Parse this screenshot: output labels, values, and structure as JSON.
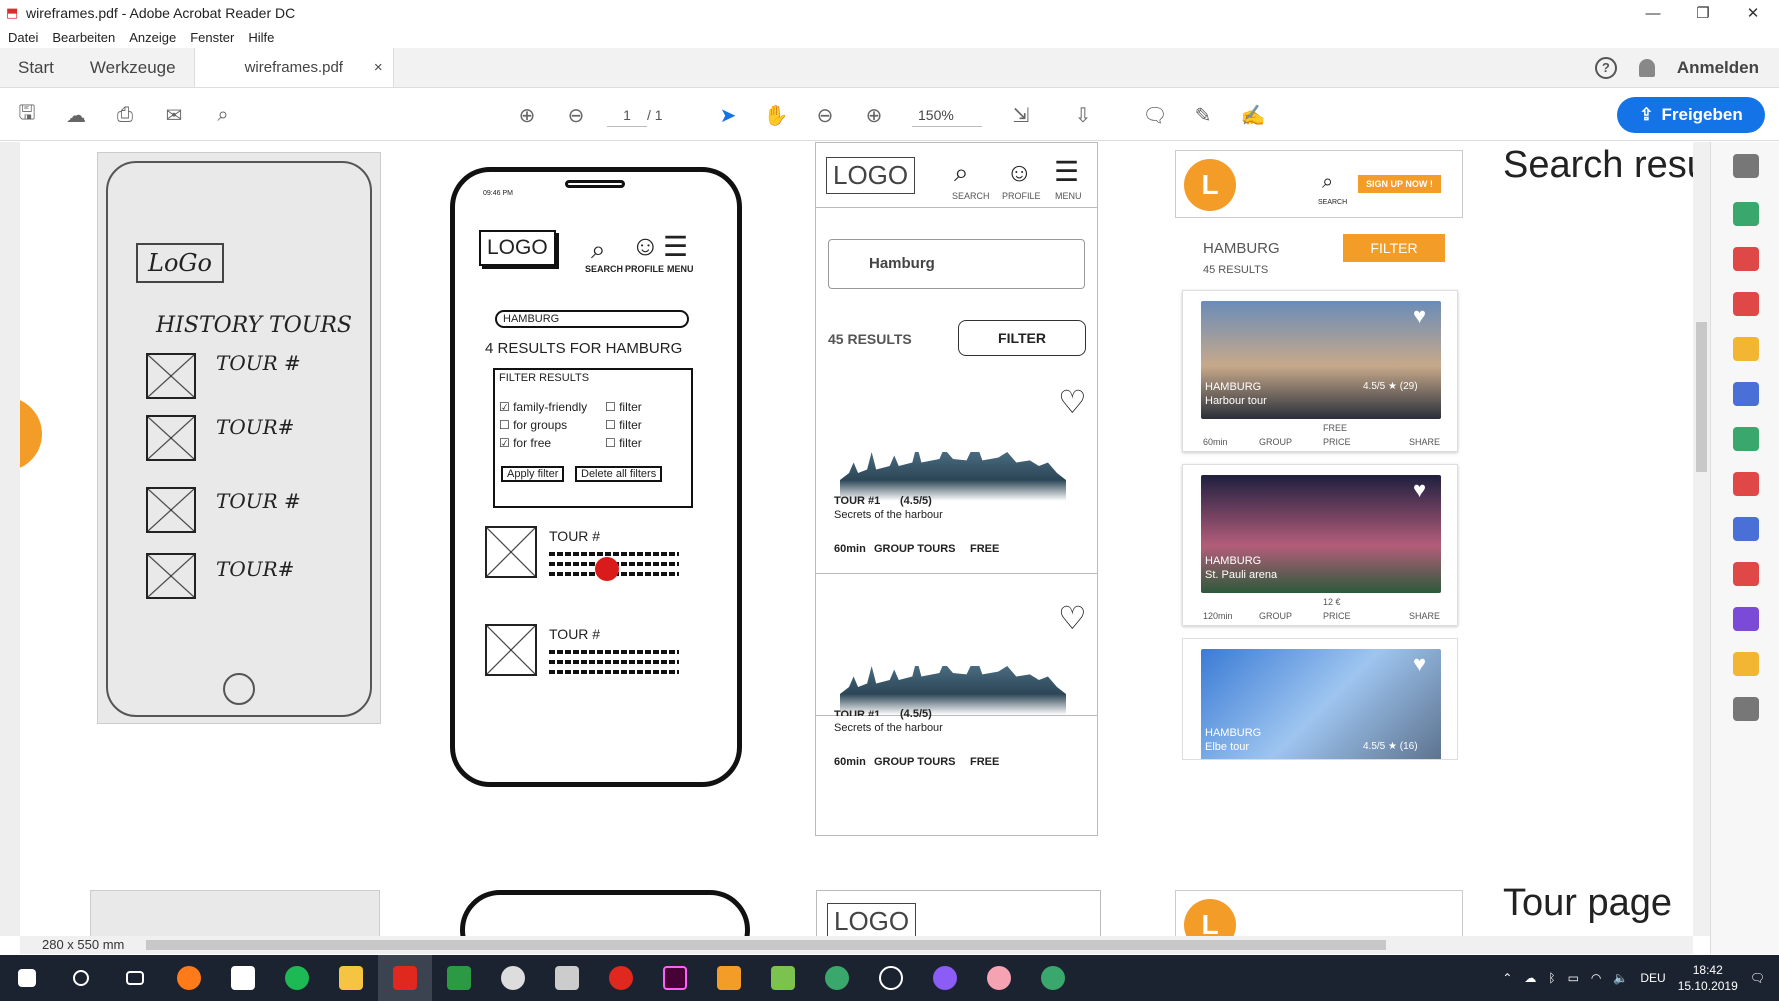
{
  "window": {
    "title": "wireframes.pdf - Adobe Acrobat Reader DC"
  },
  "menu": [
    "Datei",
    "Bearbeiten",
    "Anzeige",
    "Fenster",
    "Hilfe"
  ],
  "tabs": {
    "start": "Start",
    "tools": "Werkzeuge",
    "doc": "wireframes.pdf",
    "close": "×"
  },
  "header": {
    "help": "?",
    "signin": "Anmelden"
  },
  "toolbar": {
    "page_current": "1",
    "page_total": "/ 1",
    "zoom": "150%",
    "share": "Freigeben"
  },
  "status": {
    "page_size": "280 x 550 mm"
  },
  "sketch1": {
    "logo": "LoGo",
    "heading": "HISTORY TOURS",
    "items": [
      "TOUR #",
      "TOUR#",
      "TOUR #",
      "TOUR#"
    ]
  },
  "phone2": {
    "time": "09:46 PM",
    "logo": "LOGO",
    "nav": [
      "SEARCH",
      "PROFILE",
      "MENU"
    ],
    "search": "HAMBURG",
    "results": "4 RESULTS FOR HAMBURG",
    "filter_title": "FILTER RESULTS",
    "filters_left": [
      "family-friendly",
      "for groups",
      "for free"
    ],
    "filters_right": [
      "filter",
      "filter",
      "filter"
    ],
    "apply": "Apply filter",
    "delete": "Delete all filters",
    "tour_label": "TOUR #"
  },
  "wf3": {
    "logo": "LOGO",
    "nav": [
      "SEARCH",
      "PROFILE",
      "MENU"
    ],
    "search": "Hamburg",
    "results": "45 RESULTS",
    "filter": "FILTER",
    "cards": [
      {
        "title": "TOUR #1",
        "rating": "(4.5/5)",
        "subtitle": "Secrets of the harbour",
        "duration": "60min",
        "group": "GROUP TOURS",
        "price": "FREE"
      },
      {
        "title": "TOUR #1",
        "rating": "(4.5/5)",
        "subtitle": "Secrets of the harbour",
        "duration": "60min",
        "group": "GROUP TOURS",
        "price": "FREE"
      }
    ]
  },
  "wf4": {
    "logo_letter": "L",
    "search_label": "SEARCH",
    "signup": "SIGN UP NOW !",
    "city": "HAMBURG",
    "filter": "FILTER",
    "results": "45 RESULTS",
    "cards": [
      {
        "city": "HAMBURG",
        "name": "Harbour tour",
        "rating": "4.5/5 ★ (29)",
        "time": "60min",
        "group": "GROUP",
        "price_val": "FREE",
        "price": "PRICE",
        "share": "SHARE"
      },
      {
        "city": "HAMBURG",
        "name": "St. Pauli arena",
        "rating": "",
        "time": "120min",
        "group": "GROUP",
        "price_val": "12 €",
        "price": "PRICE",
        "share": "SHARE"
      },
      {
        "city": "HAMBURG",
        "name": "Elbe tour",
        "rating": "4.5/5 ★ (16)"
      }
    ]
  },
  "headings": {
    "search": "Search resu",
    "tour": "Tour page"
  },
  "tray": {
    "lang": "DEU",
    "time": "18:42",
    "date": "15.10.2019"
  }
}
